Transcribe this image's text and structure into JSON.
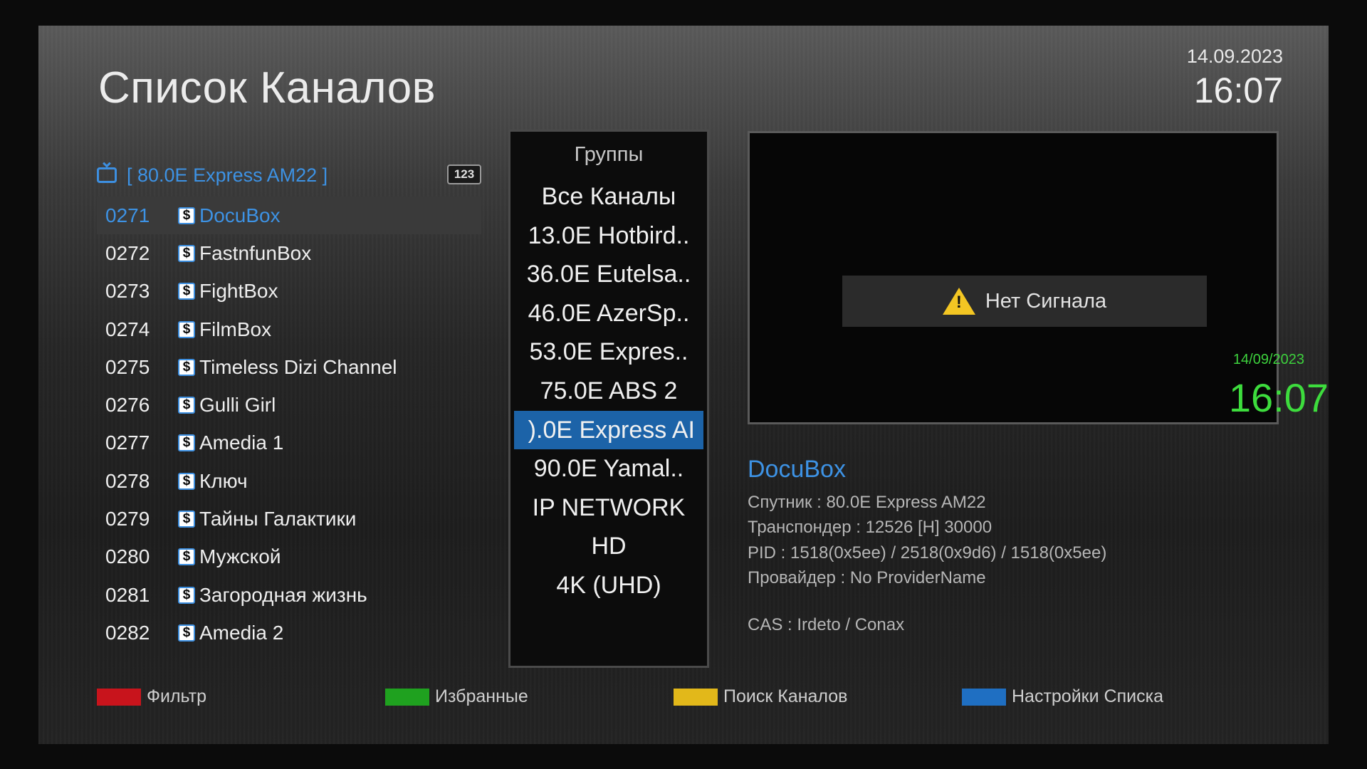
{
  "header": {
    "title": "Список Каналов",
    "date": "14.09.2023",
    "time": "16:07"
  },
  "channel_list": {
    "satellite": "[ 80.0E Express AM22 ]",
    "badge": "123",
    "header_icon": "tv-icon",
    "scrambled_icon_glyph": "$",
    "items": [
      {
        "num": "0271",
        "name": "DocuBox"
      },
      {
        "num": "0272",
        "name": "FastnfunBox"
      },
      {
        "num": "0273",
        "name": "FightBox"
      },
      {
        "num": "0274",
        "name": "FilmBox"
      },
      {
        "num": "0275",
        "name": "Timeless Dizi Channel"
      },
      {
        "num": "0276",
        "name": "Gulli Girl"
      },
      {
        "num": "0277",
        "name": "Amedia 1"
      },
      {
        "num": "0278",
        "name": "Ключ"
      },
      {
        "num": "0279",
        "name": "Тайны Галактики"
      },
      {
        "num": "0280",
        "name": "Мужской"
      },
      {
        "num": "0281",
        "name": "Загородная жизнь"
      },
      {
        "num": "0282",
        "name": "Amedia 2"
      }
    ],
    "selected_index": 0
  },
  "groups": {
    "title": "Группы",
    "items": [
      "Все Каналы",
      "13.0E Hotbird..",
      "36.0E Eutelsa..",
      "46.0E AzerSp..",
      "53.0E Expres..",
      "75.0E ABS 2",
      ").0E Express AI",
      "90.0E Yamal..",
      "IP NETWORK",
      "HD",
      "4K (UHD)"
    ],
    "selected_index": 6
  },
  "preview": {
    "no_signal": "Нет Сигнала",
    "warning_icon": "warning-icon",
    "overlay_date": "14/09/2023",
    "overlay_time": "16:07"
  },
  "info": {
    "channel_name": "DocuBox",
    "satellite": "Спутник : 80.0E Express AM22",
    "transponder": "Транспондер : 12526 [H] 30000",
    "pid": "PID : 1518(0x5ee) / 2518(0x9d6) / 1518(0x5ee)",
    "provider": "Провайдер : No ProviderName",
    "cas": "CAS : Irdeto / Conax"
  },
  "legend": [
    {
      "label": "Фильтр",
      "color": "#c8141c"
    },
    {
      "label": "Избранные",
      "color": "#1fa11f"
    },
    {
      "label": "Поиск Каналов",
      "color": "#e2b81a"
    },
    {
      "label": "Настройки Списка",
      "color": "#1f6fc2"
    }
  ],
  "colors": {
    "accent": "#3d92e4",
    "selection": "#1c63a8",
    "overlay_clock": "#3ddc3d"
  }
}
